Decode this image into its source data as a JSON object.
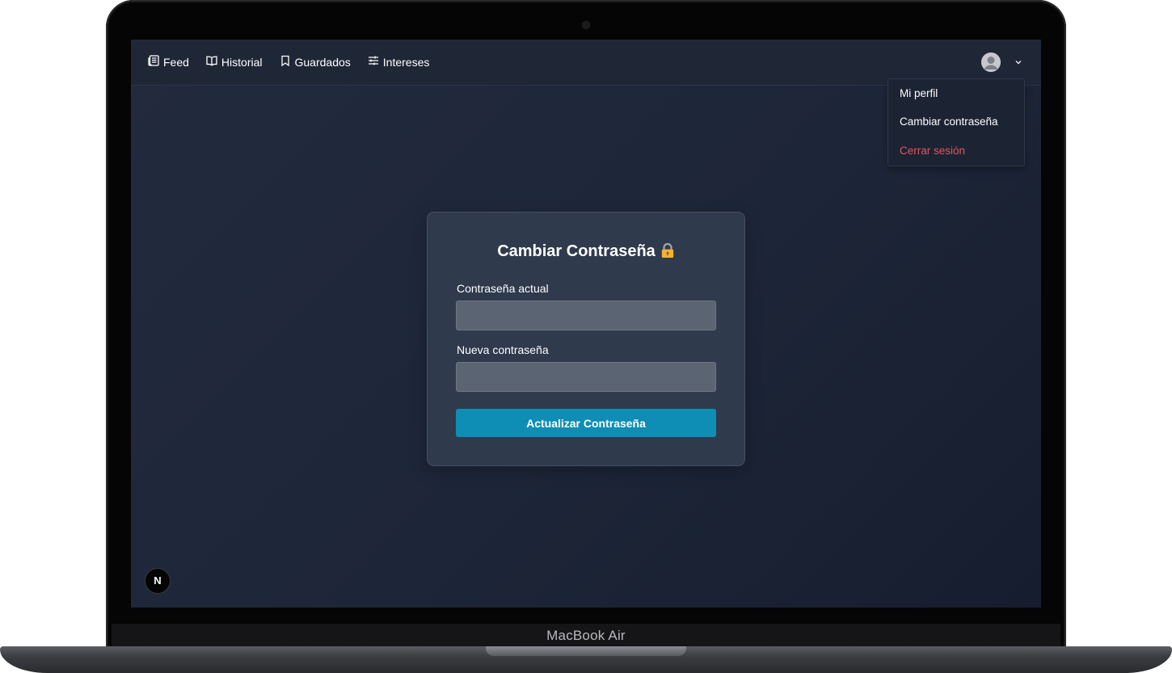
{
  "device": {
    "label": "MacBook Air"
  },
  "nav": {
    "items": [
      {
        "label": "Feed",
        "icon": "newspaper-icon"
      },
      {
        "label": "Historial",
        "icon": "book-open-icon"
      },
      {
        "label": "Guardados",
        "icon": "bookmark-icon"
      },
      {
        "label": "Intereses",
        "icon": "sliders-icon"
      }
    ],
    "avatar_icon": "user-avatar-icon",
    "dropdown_icon": "chevron-down-icon"
  },
  "user_menu": {
    "items": [
      {
        "label": "Mi perfil"
      },
      {
        "label": "Cambiar contraseña"
      },
      {
        "label": "Cerrar sesión",
        "color": "#e0575d"
      }
    ]
  },
  "form": {
    "title": "Cambiar Contraseña",
    "title_icon": "lock-icon",
    "current_label": "Contraseña actual",
    "current_value": "",
    "new_label": "Nueva contraseña",
    "new_value": "",
    "submit_label": "Actualizar Contraseña"
  },
  "dev_badge": {
    "label": "N"
  },
  "colors": {
    "accent": "#0e8db5",
    "background": "#1d2638",
    "card": "#2f3a4d",
    "danger": "#e0575d"
  }
}
